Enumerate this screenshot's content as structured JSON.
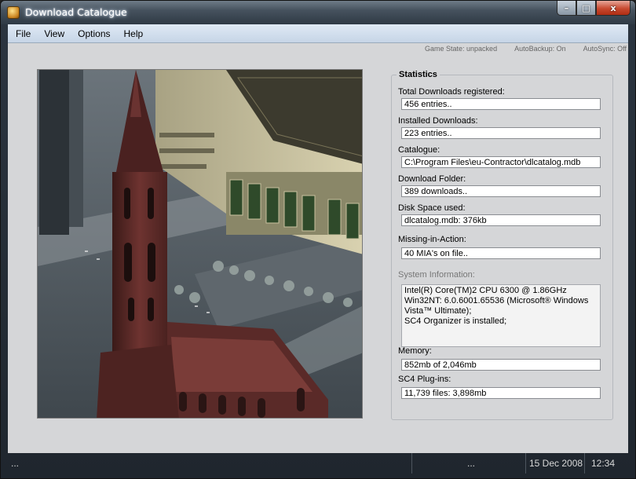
{
  "window": {
    "title": "Download Catalogue",
    "caption_min": "–",
    "caption_max": "□",
    "caption_close": "x"
  },
  "menu": [
    "File",
    "View",
    "Options",
    "Help"
  ],
  "status_flags": {
    "game_state": "Game State: unpacked",
    "autobackup": "AutoBackup: On",
    "autosync": "AutoSync: Off"
  },
  "statistics": {
    "title": "Statistics",
    "fields": [
      {
        "label": "Total Downloads registered:",
        "value": "456 entries.."
      },
      {
        "label": "Installed Downloads:",
        "value": "223 entries.."
      },
      {
        "label": "Catalogue:",
        "value": "C:\\Program Files\\eu-Contractor\\dlcatalog.mdb"
      },
      {
        "label": "Download Folder:",
        "value": "389 downloads.."
      },
      {
        "label": "Disk Space used:",
        "value": "dlcatalog.mdb: 376kb"
      },
      {
        "label": "Missing-in-Action:",
        "value": "40 MIA's on file.."
      }
    ],
    "system_info": {
      "label": "System Information:",
      "lines": [
        "Intel(R) Core(TM)2 CPU      6300  @ 1.86GHz",
        "Win32NT: 6.0.6001.65536 (Microsoft® Windows",
        "Vista™ Ultimate);",
        "SC4 Organizer is installed;"
      ]
    },
    "memory": {
      "label": "Memory:",
      "value": "852mb of 2,046mb"
    },
    "plugins": {
      "label": "SC4 Plug-ins:",
      "value": "11,739 files: 3,898mb"
    }
  },
  "statusbar": {
    "pane1": "...",
    "pane2": "...",
    "date": "15 Dec 2008",
    "time": "12:34"
  },
  "colors": {
    "frame": "#2b3540",
    "client_bg": "#d5d6d8",
    "menubar": "#d3dfee"
  }
}
